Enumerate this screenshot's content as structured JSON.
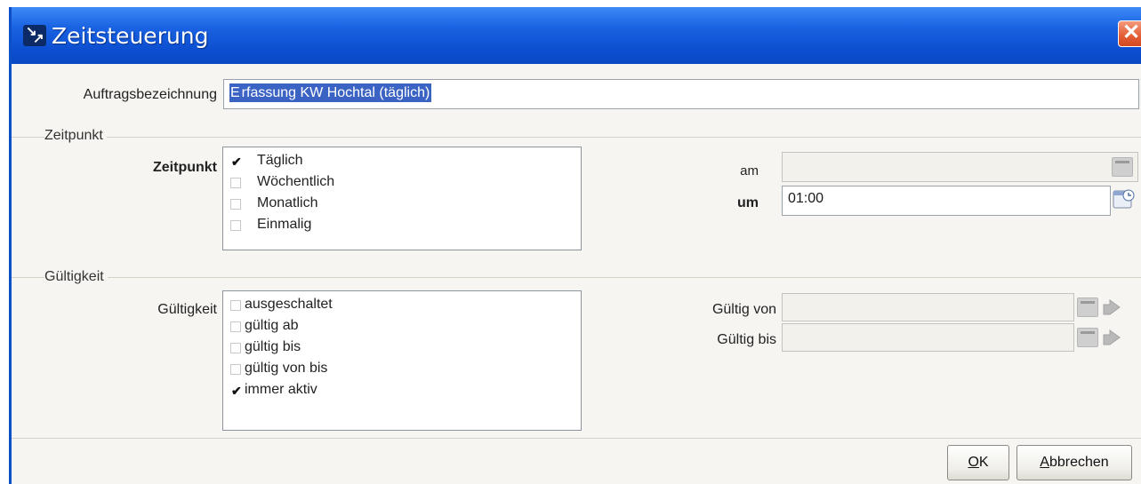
{
  "window": {
    "title": "Zeitsteuerung",
    "close_glyph": "✕",
    "accent_color": "#0c4fd0",
    "close_color": "#e45c33"
  },
  "auftrag": {
    "label": "Auftragsbezeichnung",
    "value_cursor": "E",
    "value_selected": "rfassung KW Hochtal (täglich)"
  },
  "zeitpunkt_group": {
    "title": "Zeitpunkt",
    "field_label": "Zeitpunkt",
    "options": [
      {
        "label": "Täglich",
        "checked": true
      },
      {
        "label": "Wöchentlich",
        "checked": false
      },
      {
        "label": "Monatlich",
        "checked": false
      },
      {
        "label": "Einmalig",
        "checked": false
      }
    ],
    "am_label": "am",
    "am_value": "",
    "um_label": "um",
    "um_value": "01:00"
  },
  "gueltigkeit_group": {
    "title": "Gültigkeit",
    "field_label": "Gültigkeit",
    "options": [
      {
        "label": "ausgeschaltet",
        "checked": false
      },
      {
        "label": "gültig ab",
        "checked": false
      },
      {
        "label": "gültig bis",
        "checked": false
      },
      {
        "label": "gültig von bis",
        "checked": false
      },
      {
        "label": "immer aktiv",
        "checked": true
      }
    ],
    "von_label": "Gültig von",
    "von_value": "",
    "bis_label": "Gültig bis",
    "bis_value": ""
  },
  "buttons": {
    "ok_mnemonic": "O",
    "ok_rest": "K",
    "cancel_mnemonic": "A",
    "cancel_rest": "bbrechen"
  },
  "check_glyph": "✔",
  "icons": [
    "app-icon",
    "close-icon",
    "calendar-icon",
    "clock-icon",
    "arrow-icon",
    "checkmark-icon"
  ]
}
